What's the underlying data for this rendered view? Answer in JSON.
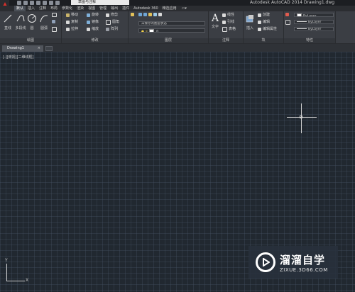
{
  "title_bar": {
    "workspace": "草图与注释",
    "title": "Autodesk AutoCAD 2014    Drawing1.dwg"
  },
  "ribbon_tabs": [
    {
      "label": "默认",
      "active": true
    },
    {
      "label": "插入"
    },
    {
      "label": "注释"
    },
    {
      "label": "布局"
    },
    {
      "label": "参数化"
    },
    {
      "label": "渲染"
    },
    {
      "label": "视图"
    },
    {
      "label": "管理"
    },
    {
      "label": "输出"
    },
    {
      "label": "插件"
    },
    {
      "label": "Autodesk 360"
    },
    {
      "label": "精选应用"
    }
  ],
  "ribbon": {
    "draw": {
      "label": "绘图",
      "line": "直线",
      "polyline": "多段线",
      "circle": "圆",
      "arc": "圆弧"
    },
    "modify": {
      "label": "修改",
      "move": "移动",
      "rotate": "旋转",
      "trim": "修剪",
      "copy": "复制",
      "mirror": "镜像",
      "fillet": "圆角",
      "stretch": "拉伸",
      "scale": "缩放",
      "array": "阵列"
    },
    "layers": {
      "label": "图层",
      "state": "未保存的图层状态",
      "current": "0"
    },
    "annotation": {
      "label": "注释",
      "text": "文字",
      "dimension": "线性",
      "leader": "引线",
      "table": "表格"
    },
    "block": {
      "label": "块",
      "insert": "插入",
      "create": "创建",
      "edit": "编辑",
      "edit_attr": "编辑属性"
    },
    "properties": {
      "label": "特性",
      "color": "ByLayer",
      "linetype": "ByLayer",
      "lineweight": "ByLayer"
    }
  },
  "doc_tabs": [
    {
      "label": "Drawing1",
      "close": "×"
    }
  ],
  "viewport": {
    "label": "[-][俯视][二维线框]"
  },
  "ucs": {
    "x": "X",
    "y": "Y"
  },
  "watermark": {
    "title": "溜溜自学",
    "url": "ZIXUE.3D66.COM"
  }
}
